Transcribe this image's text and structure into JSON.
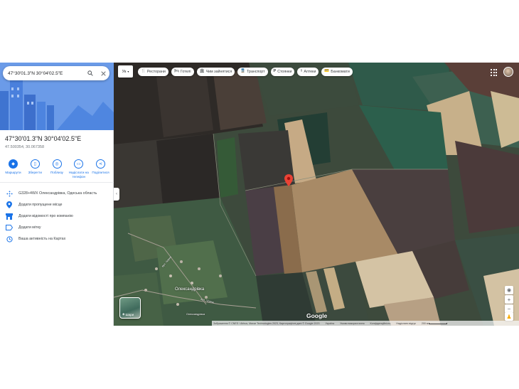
{
  "search": {
    "value": "47°30'01.3\"N 30°04'02.5\"E"
  },
  "place": {
    "title": "47°30'01.3\"N 30°04'02.5\"E",
    "subtitle": "47.500354, 30.067358"
  },
  "actions": [
    {
      "label": "Маршрути",
      "icon": "directions-icon"
    },
    {
      "label": "Зберегти",
      "icon": "bookmark-icon"
    },
    {
      "label": "Поблизу",
      "icon": "nearby-icon"
    },
    {
      "label": "Надіслати на телефон",
      "icon": "phone-icon"
    },
    {
      "label": "Поділитися",
      "icon": "share-icon"
    }
  ],
  "rows": [
    {
      "label": "G328+4WX Олександрівка, Одеська область",
      "icon": "plus-code-icon"
    },
    {
      "label": "Додати пропущене місце",
      "icon": "add-place-icon"
    },
    {
      "label": "Додати відомості про компанію",
      "icon": "business-icon"
    },
    {
      "label": "Додати мітку",
      "icon": "label-icon"
    },
    {
      "label": "Ваша активність на Картах",
      "icon": "history-icon"
    }
  ],
  "map": {
    "language": "Ук",
    "chips": [
      {
        "label": "Ресторани",
        "icon": "restaurant-icon"
      },
      {
        "label": "Готелі",
        "icon": "hotel-icon"
      },
      {
        "label": "Чим зайнятися",
        "icon": "things-to-do-icon"
      },
      {
        "label": "Транспорт",
        "icon": "transit-icon"
      },
      {
        "label": "Стоянки",
        "icon": "parking-icon"
      },
      {
        "label": "Аптеки",
        "icon": "pharmacy-icon"
      },
      {
        "label": "Банкомати",
        "icon": "atm-icon"
      }
    ],
    "town_label": "Олександрівка",
    "road_labels": [
      "вул. Чорна",
      "вул. Чорна",
      "Олександрівка"
    ],
    "layers_label": "Шари",
    "google": "Google",
    "footer": [
      "Зображення © CNES / Airbus, Maxar Technologies 2023, Картографічні дані © Google 2023",
      "Україна",
      "Умови використання",
      "Конфіденційність",
      "Надіслати відгук",
      "200 м"
    ]
  }
}
